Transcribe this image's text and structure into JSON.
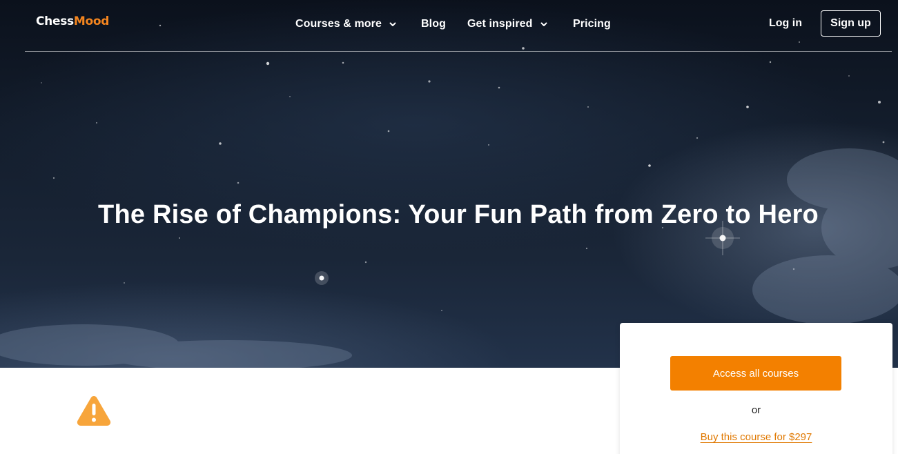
{
  "brand": {
    "logo_text_main": "Chess",
    "logo_text_accent": "Mood",
    "accent_color": "#f4851f"
  },
  "nav": {
    "items": [
      {
        "label": "Courses & more",
        "has_dropdown": true
      },
      {
        "label": "Blog",
        "has_dropdown": false
      },
      {
        "label": "Get inspired",
        "has_dropdown": true
      },
      {
        "label": "Pricing",
        "has_dropdown": false
      }
    ],
    "login_label": "Log in",
    "signup_label": "Sign up"
  },
  "hero": {
    "title": "The Rise of Champions: Your Fun Path from Zero to Hero"
  },
  "content": {
    "warning_icon": "warning-triangle-icon"
  },
  "purchase_card": {
    "primary_label": "Access all courses",
    "separator": "or",
    "buy_link_label": "Buy this course for $297",
    "button_color": "#f38000"
  }
}
